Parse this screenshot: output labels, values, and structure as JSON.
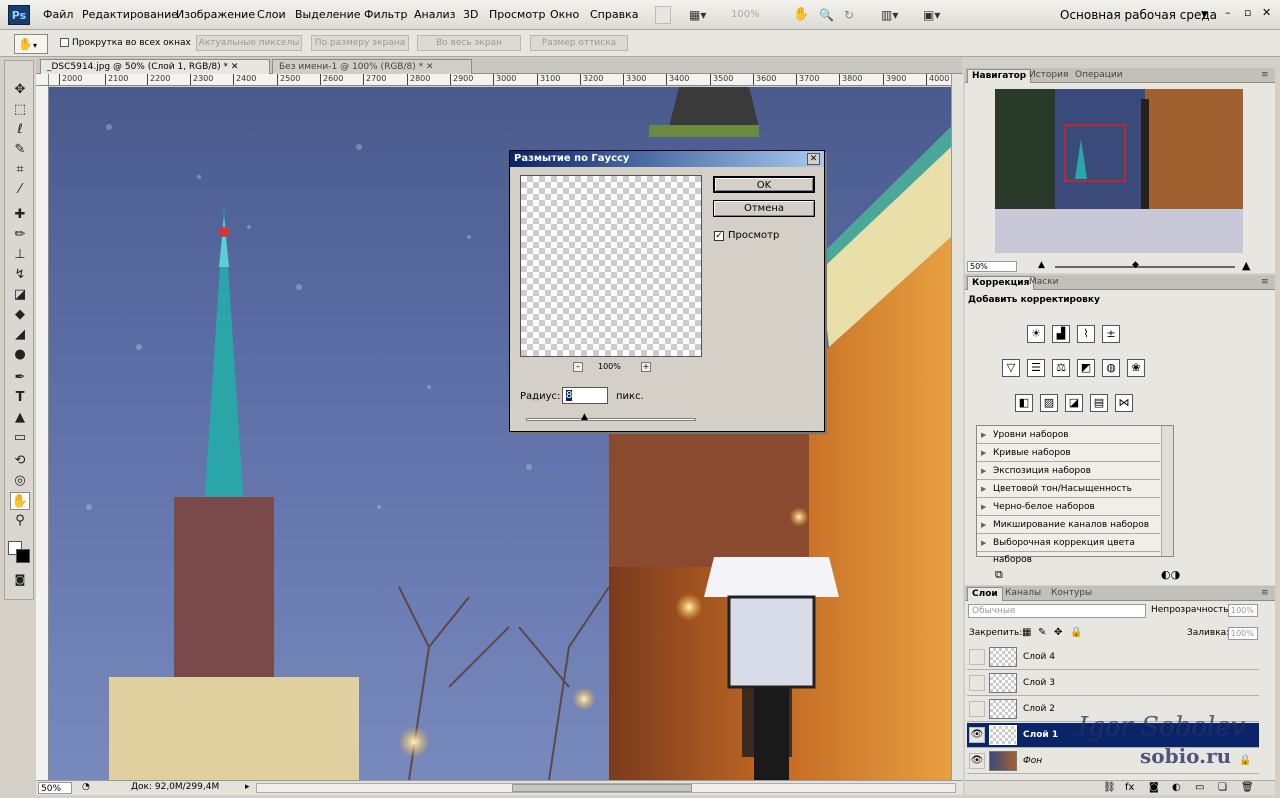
{
  "app": {
    "logo": "Ps",
    "workspace": "Основная рабочая среда",
    "zoom_menu": "100%"
  },
  "menu": [
    "Файл",
    "Редактирование",
    "Изображение",
    "Слои",
    "Выделение",
    "Фильтр",
    "Анализ",
    "3D",
    "Просмотр",
    "Окно",
    "Справка"
  ],
  "options": {
    "scroll_all": "Прокрутка во всех окнах",
    "buttons": [
      "Актуальные пикселы",
      "По размеру экрана",
      "Во весь экран",
      "Размер оттиска"
    ]
  },
  "tabs": [
    "_DSC5914.jpg @ 50% (Слой 1, RGB/8) *",
    "Без имени-1 @ 100% (RGB/8) *"
  ],
  "ruler": [
    "2000",
    "2100",
    "2200",
    "2300",
    "2400",
    "2500",
    "2600",
    "2700",
    "2800",
    "2900",
    "3000",
    "3100",
    "3200",
    "3300",
    "3400",
    "3500",
    "3600",
    "3700",
    "3800",
    "3900",
    "4000"
  ],
  "status": {
    "zoom": "50%",
    "doc": "Док: 92,0M/299,4M"
  },
  "dialog": {
    "title": "Размытие по Гауссу",
    "ok": "OK",
    "cancel": "Отмена",
    "preview": "Просмотр",
    "zoom": "100%",
    "radius_label": "Радиус:",
    "radius_value": "8",
    "unit": "пикс."
  },
  "navigator": {
    "tabs": [
      "Навигатор",
      "История",
      "Операции"
    ],
    "zoom": "50%"
  },
  "adjustments": {
    "tabs": [
      "Коррекция",
      "Маски"
    ],
    "heading": "Добавить корректировку",
    "presets": [
      "Уровни наборов",
      "Кривые наборов",
      "Экспозиция наборов",
      "Цветовой тон/Насыщенность наборов",
      "Черно-белое наборов",
      "Микширование каналов наборов",
      "Выборочная коррекция цвета наборов"
    ]
  },
  "layers": {
    "tabs": [
      "Слои",
      "Каналы",
      "Контуры"
    ],
    "blend": "Обычные",
    "opacity_label": "Непрозрачность:",
    "opacity": "100%",
    "lock_label": "Закрепить:",
    "fill_label": "Заливка:",
    "fill": "100%",
    "items": [
      "Слой 4",
      "Слой 3",
      "Слой 2",
      "Слой 1",
      "Фон"
    ]
  },
  "watermark": {
    "name": "Igor Sobolev",
    "site": "sobio.ru"
  }
}
